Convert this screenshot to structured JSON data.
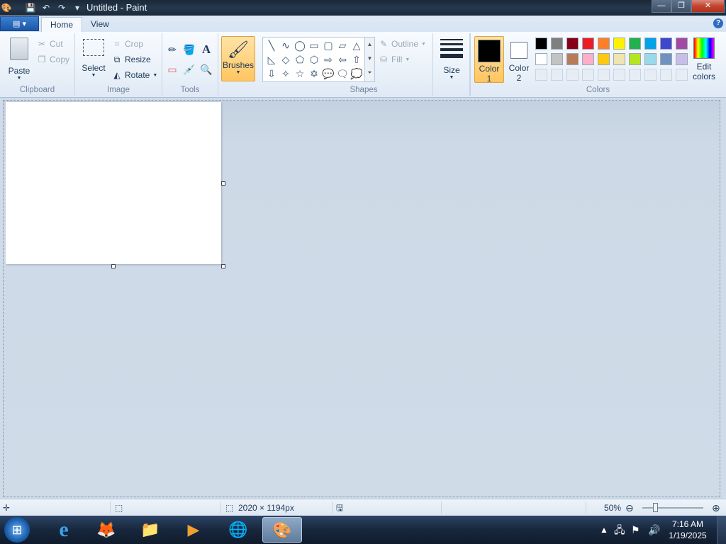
{
  "window": {
    "title": "Untitled - Paint",
    "min": "—",
    "max": "❐",
    "close": "✕"
  },
  "qat": {
    "app_icon": "🎨",
    "save": "💾",
    "undo": "↶",
    "redo": "↷",
    "customize": "▾"
  },
  "tabs": {
    "app_menu": "▤ ▾",
    "home": "Home",
    "view": "View",
    "help": "?"
  },
  "clipboard": {
    "paste": "Paste",
    "cut": "Cut",
    "copy": "Copy",
    "label": "Clipboard"
  },
  "image": {
    "select": "Select",
    "crop": "Crop",
    "resize": "Resize",
    "rotate": "Rotate",
    "label": "Image"
  },
  "tools": {
    "label": "Tools",
    "pencil": "✏",
    "fill": "🪣",
    "text": "A",
    "eraser": "▭",
    "picker": "💉",
    "magnifier": "🔍"
  },
  "brushes": {
    "label": "Brushes"
  },
  "shapes": {
    "label": "Shapes",
    "outline": "Outline",
    "fill": "Fill",
    "glyphs": [
      "╲",
      "∿",
      "◯",
      "▭",
      "▢",
      "▱",
      "△",
      "◺",
      "◇",
      "⬠",
      "⬡",
      "⇨",
      "⇦",
      "⇧",
      "⇩",
      "✧",
      "☆",
      "✡",
      "💬",
      "🗨",
      "💭"
    ]
  },
  "size": {
    "label": "Size"
  },
  "colors": {
    "label": "Colors",
    "color1_line1": "Color",
    "color1_line2": "1",
    "color2_line1": "Color",
    "color2_line2": "2",
    "edit_line1": "Edit",
    "edit_line2": "colors",
    "color1": "#000000",
    "color2": "#ffffff",
    "palette_row1": [
      "#000000",
      "#7f7f7f",
      "#880015",
      "#ed1c24",
      "#ff7f27",
      "#fff200",
      "#22b14c",
      "#00a2e8",
      "#3f48cc",
      "#a349a4"
    ],
    "palette_row2": [
      "#ffffff",
      "#c3c3c3",
      "#b97a57",
      "#ffaec9",
      "#ffc90e",
      "#efe4b0",
      "#b5e61d",
      "#99d9ea",
      "#7092be",
      "#c8bfe7"
    ]
  },
  "status": {
    "dimensions": "2020 × 1194px",
    "zoom": "50%",
    "zoom_level": 0.5
  },
  "taskbar": {
    "start": "⊞",
    "apps": [
      "e",
      "🦊",
      "📁",
      "▶",
      "🌐",
      "🎨"
    ],
    "time": "7:16 AM",
    "date": "1/19/2025"
  }
}
